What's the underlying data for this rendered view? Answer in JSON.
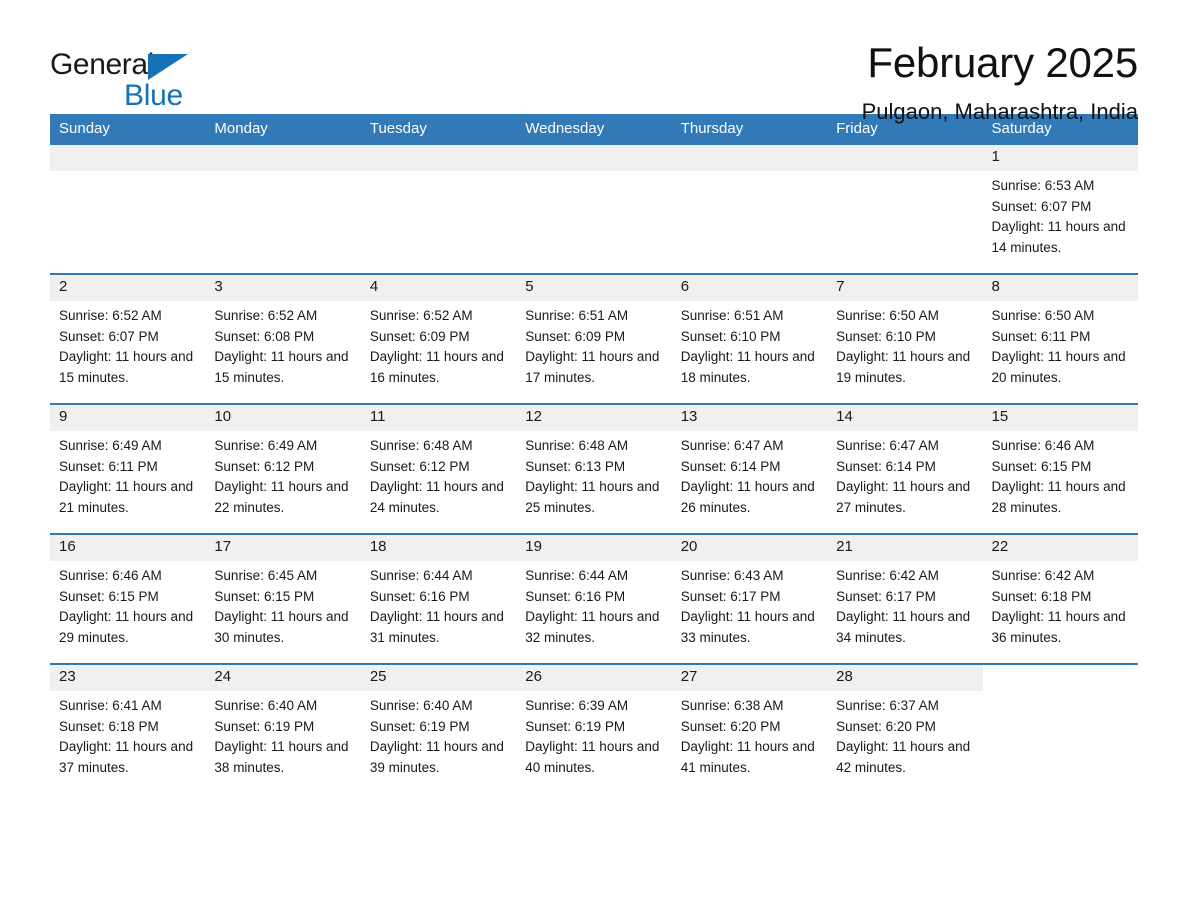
{
  "brand": {
    "name_part1": "General",
    "name_part2": "Blue",
    "triangle_color": "#1572b6"
  },
  "header": {
    "title": "February 2025",
    "subtitle": "Pulgaon, Maharashtra, India",
    "accent_color": "#3279b7"
  },
  "calendar": {
    "weekday_headers": [
      "Sunday",
      "Monday",
      "Tuesday",
      "Wednesday",
      "Thursday",
      "Friday",
      "Saturday"
    ],
    "weeks": [
      [
        {
          "day": "",
          "blank": true
        },
        {
          "day": "",
          "blank": true
        },
        {
          "day": "",
          "blank": true
        },
        {
          "day": "",
          "blank": true
        },
        {
          "day": "",
          "blank": true
        },
        {
          "day": "",
          "blank": true
        },
        {
          "day": "1",
          "sunrise": "Sunrise: 6:53 AM",
          "sunset": "Sunset: 6:07 PM",
          "daylight": "Daylight: 11 hours and 14 minutes."
        }
      ],
      [
        {
          "day": "2",
          "sunrise": "Sunrise: 6:52 AM",
          "sunset": "Sunset: 6:07 PM",
          "daylight": "Daylight: 11 hours and 15 minutes."
        },
        {
          "day": "3",
          "sunrise": "Sunrise: 6:52 AM",
          "sunset": "Sunset: 6:08 PM",
          "daylight": "Daylight: 11 hours and 15 minutes."
        },
        {
          "day": "4",
          "sunrise": "Sunrise: 6:52 AM",
          "sunset": "Sunset: 6:09 PM",
          "daylight": "Daylight: 11 hours and 16 minutes."
        },
        {
          "day": "5",
          "sunrise": "Sunrise: 6:51 AM",
          "sunset": "Sunset: 6:09 PM",
          "daylight": "Daylight: 11 hours and 17 minutes."
        },
        {
          "day": "6",
          "sunrise": "Sunrise: 6:51 AM",
          "sunset": "Sunset: 6:10 PM",
          "daylight": "Daylight: 11 hours and 18 minutes."
        },
        {
          "day": "7",
          "sunrise": "Sunrise: 6:50 AM",
          "sunset": "Sunset: 6:10 PM",
          "daylight": "Daylight: 11 hours and 19 minutes."
        },
        {
          "day": "8",
          "sunrise": "Sunrise: 6:50 AM",
          "sunset": "Sunset: 6:11 PM",
          "daylight": "Daylight: 11 hours and 20 minutes."
        }
      ],
      [
        {
          "day": "9",
          "sunrise": "Sunrise: 6:49 AM",
          "sunset": "Sunset: 6:11 PM",
          "daylight": "Daylight: 11 hours and 21 minutes."
        },
        {
          "day": "10",
          "sunrise": "Sunrise: 6:49 AM",
          "sunset": "Sunset: 6:12 PM",
          "daylight": "Daylight: 11 hours and 22 minutes."
        },
        {
          "day": "11",
          "sunrise": "Sunrise: 6:48 AM",
          "sunset": "Sunset: 6:12 PM",
          "daylight": "Daylight: 11 hours and 24 minutes."
        },
        {
          "day": "12",
          "sunrise": "Sunrise: 6:48 AM",
          "sunset": "Sunset: 6:13 PM",
          "daylight": "Daylight: 11 hours and 25 minutes."
        },
        {
          "day": "13",
          "sunrise": "Sunrise: 6:47 AM",
          "sunset": "Sunset: 6:14 PM",
          "daylight": "Daylight: 11 hours and 26 minutes."
        },
        {
          "day": "14",
          "sunrise": "Sunrise: 6:47 AM",
          "sunset": "Sunset: 6:14 PM",
          "daylight": "Daylight: 11 hours and 27 minutes."
        },
        {
          "day": "15",
          "sunrise": "Sunrise: 6:46 AM",
          "sunset": "Sunset: 6:15 PM",
          "daylight": "Daylight: 11 hours and 28 minutes."
        }
      ],
      [
        {
          "day": "16",
          "sunrise": "Sunrise: 6:46 AM",
          "sunset": "Sunset: 6:15 PM",
          "daylight": "Daylight: 11 hours and 29 minutes."
        },
        {
          "day": "17",
          "sunrise": "Sunrise: 6:45 AM",
          "sunset": "Sunset: 6:15 PM",
          "daylight": "Daylight: 11 hours and 30 minutes."
        },
        {
          "day": "18",
          "sunrise": "Sunrise: 6:44 AM",
          "sunset": "Sunset: 6:16 PM",
          "daylight": "Daylight: 11 hours and 31 minutes."
        },
        {
          "day": "19",
          "sunrise": "Sunrise: 6:44 AM",
          "sunset": "Sunset: 6:16 PM",
          "daylight": "Daylight: 11 hours and 32 minutes."
        },
        {
          "day": "20",
          "sunrise": "Sunrise: 6:43 AM",
          "sunset": "Sunset: 6:17 PM",
          "daylight": "Daylight: 11 hours and 33 minutes."
        },
        {
          "day": "21",
          "sunrise": "Sunrise: 6:42 AM",
          "sunset": "Sunset: 6:17 PM",
          "daylight": "Daylight: 11 hours and 34 minutes."
        },
        {
          "day": "22",
          "sunrise": "Sunrise: 6:42 AM",
          "sunset": "Sunset: 6:18 PM",
          "daylight": "Daylight: 11 hours and 36 minutes."
        }
      ],
      [
        {
          "day": "23",
          "sunrise": "Sunrise: 6:41 AM",
          "sunset": "Sunset: 6:18 PM",
          "daylight": "Daylight: 11 hours and 37 minutes."
        },
        {
          "day": "24",
          "sunrise": "Sunrise: 6:40 AM",
          "sunset": "Sunset: 6:19 PM",
          "daylight": "Daylight: 11 hours and 38 minutes."
        },
        {
          "day": "25",
          "sunrise": "Sunrise: 6:40 AM",
          "sunset": "Sunset: 6:19 PM",
          "daylight": "Daylight: 11 hours and 39 minutes."
        },
        {
          "day": "26",
          "sunrise": "Sunrise: 6:39 AM",
          "sunset": "Sunset: 6:19 PM",
          "daylight": "Daylight: 11 hours and 40 minutes."
        },
        {
          "day": "27",
          "sunrise": "Sunrise: 6:38 AM",
          "sunset": "Sunset: 6:20 PM",
          "daylight": "Daylight: 11 hours and 41 minutes."
        },
        {
          "day": "28",
          "sunrise": "Sunrise: 6:37 AM",
          "sunset": "Sunset: 6:20 PM",
          "daylight": "Daylight: 11 hours and 42 minutes."
        },
        {
          "day": "",
          "blank": true
        }
      ]
    ]
  }
}
